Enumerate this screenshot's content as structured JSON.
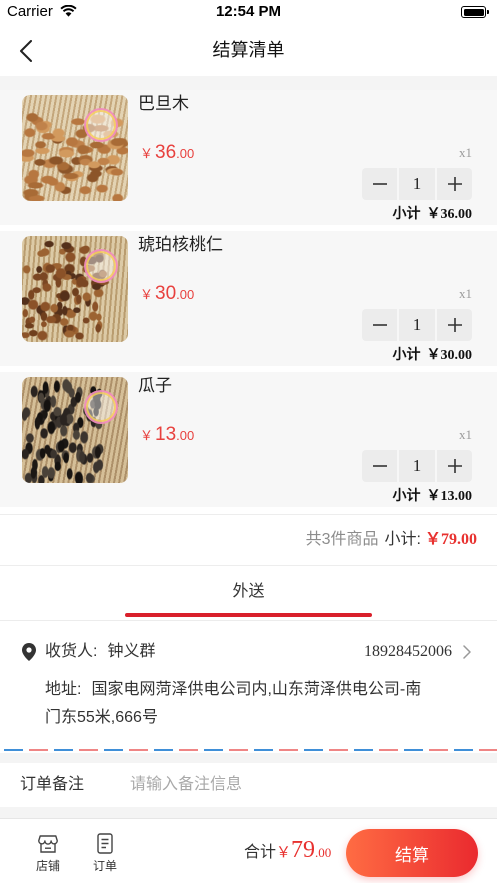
{
  "status_bar": {
    "carrier": "Carrier",
    "time": "12:54 PM",
    "battery_level": 1.0
  },
  "nav": {
    "title": "结算清单"
  },
  "colors": {
    "price": "#e8413e",
    "accent": "#d9202b",
    "checkout_gradient": [
      "#ff6c43",
      "#ea2a2f"
    ],
    "airmail_blue": "#3f8fd8",
    "airmail_red": "#ef8585"
  },
  "items": [
    {
      "name": "巴旦木",
      "currency": "￥",
      "price_int": "36",
      "price_dec": ".00",
      "qty_label": "x1",
      "quantity": "1",
      "subtotal_label": "小计",
      "subtotal": "￥36.00"
    },
    {
      "name": "琥珀核桃仁",
      "currency": "￥",
      "price_int": "30",
      "price_dec": ".00",
      "qty_label": "x1",
      "quantity": "1",
      "subtotal_label": "小计",
      "subtotal": "￥30.00"
    },
    {
      "name": "瓜子",
      "currency": "￥",
      "price_int": "13",
      "price_dec": ".00",
      "qty_label": "x1",
      "quantity": "1",
      "subtotal_label": "小计",
      "subtotal": "￥13.00"
    }
  ],
  "summary": {
    "count_text": "共3件商品",
    "subtotal_label": "小计:",
    "subtotal": "￥79.00"
  },
  "delivery_tabs": [
    {
      "label": "外送",
      "active": true
    }
  ],
  "address": {
    "receiver_label": "收货人:",
    "receiver_name": "钟义群",
    "phone": "18928452006",
    "address_label": "地址:",
    "address_lines": [
      "国家电网菏泽供电公司内,山东菏泽供电公司-南",
      "门东55米,666号"
    ]
  },
  "remark": {
    "label": "订单备注",
    "placeholder": "请输入备注信息"
  },
  "bottom_bar": {
    "tabs": [
      {
        "label": "店铺",
        "icon": "store-icon"
      },
      {
        "label": "订单",
        "icon": "order-icon"
      }
    ],
    "total_label": "合计",
    "total_currency": "￥",
    "total_int": "79",
    "total_dec": ".00",
    "checkout_label": "结算"
  },
  "icons": {
    "back": "chevron-left-icon",
    "location": "location-pin-icon",
    "address_arrow": "chevron-right-icon",
    "decrease": "minus-icon",
    "increase": "plus-icon",
    "wifi": "wifi-icon",
    "battery": "battery-icon"
  }
}
